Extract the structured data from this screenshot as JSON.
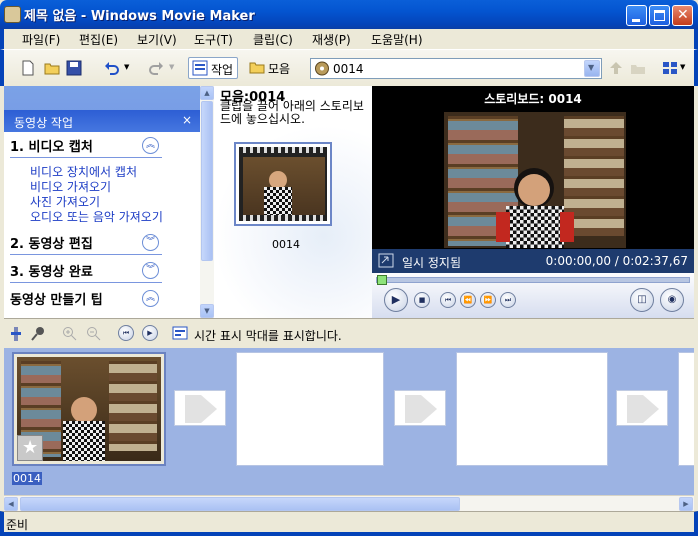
{
  "window": {
    "title": "제목 없음 - Windows Movie Maker"
  },
  "menu": [
    "파일(F)",
    "편집(E)",
    "보기(V)",
    "도구(T)",
    "클립(C)",
    "재생(P)",
    "도움말(H)"
  ],
  "toolbar": {
    "tasks_label": "작업",
    "collections_label": "모음",
    "collection_value": "0014"
  },
  "task_pane": {
    "header": "동영상 작업",
    "close": "×",
    "sections": [
      {
        "title": "1. 비디오 캡처",
        "expanded": true,
        "links": [
          "비디오 장치에서 캡처",
          "비디오 가져오기",
          "사진 가져오기",
          "오디오 또는 음악 가져오기"
        ]
      },
      {
        "title": "2. 동영상 편집",
        "expanded": false
      },
      {
        "title": "3. 동영상 완료",
        "expanded": false
      },
      {
        "title": "동영상 만들기 팁",
        "expanded": true
      }
    ]
  },
  "collection": {
    "title": "모음:0014",
    "hint": "클립을 끌어 아래의 스토리보드에 놓으십시오.",
    "clip_label": "0014"
  },
  "monitor": {
    "title": "스토리보드: 0014",
    "status": "일시 정지됨",
    "time": "0:00:00,00 / 0:02:37,67"
  },
  "timeline": {
    "toggle_text": "시간 표시 막대를 표시합니다."
  },
  "storyboard": {
    "clip_label": "0014"
  },
  "statusbar": {
    "text": "준비"
  },
  "colors": {
    "title_blue": "#0454d0",
    "task_pane_blue": "#6375d6",
    "storyboard_bg": "#9cb3e3",
    "link_blue": "#1c3cc5"
  }
}
